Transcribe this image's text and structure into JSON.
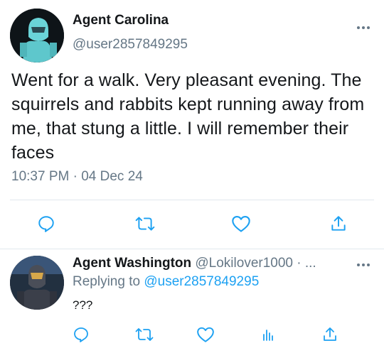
{
  "tweet": {
    "author_name": "Agent Carolina",
    "author_handle": "@user2857849295",
    "text": "Went for a walk. Very pleasant evening. The squirrels and rabbits kept running away from me, that stung a little. I will remember their faces",
    "timestamp": "10:37 PM · 04 Dec 24",
    "actions": [
      "reply-icon",
      "retweet-icon",
      "like-icon",
      "share-icon"
    ]
  },
  "reply": {
    "author_name": "Agent Washington",
    "author_handle_meta": "@Lokilover1000 · ...",
    "replying_prefix": "Replying to",
    "replying_handle": "@user2857849295",
    "text": "???",
    "actions": [
      "reply-icon",
      "retweet-icon",
      "like-icon",
      "analytics-icon",
      "share-icon"
    ]
  },
  "colors": {
    "secondary_text": "#657786",
    "link": "#1da1f2",
    "divider": "#e1e8ed"
  }
}
